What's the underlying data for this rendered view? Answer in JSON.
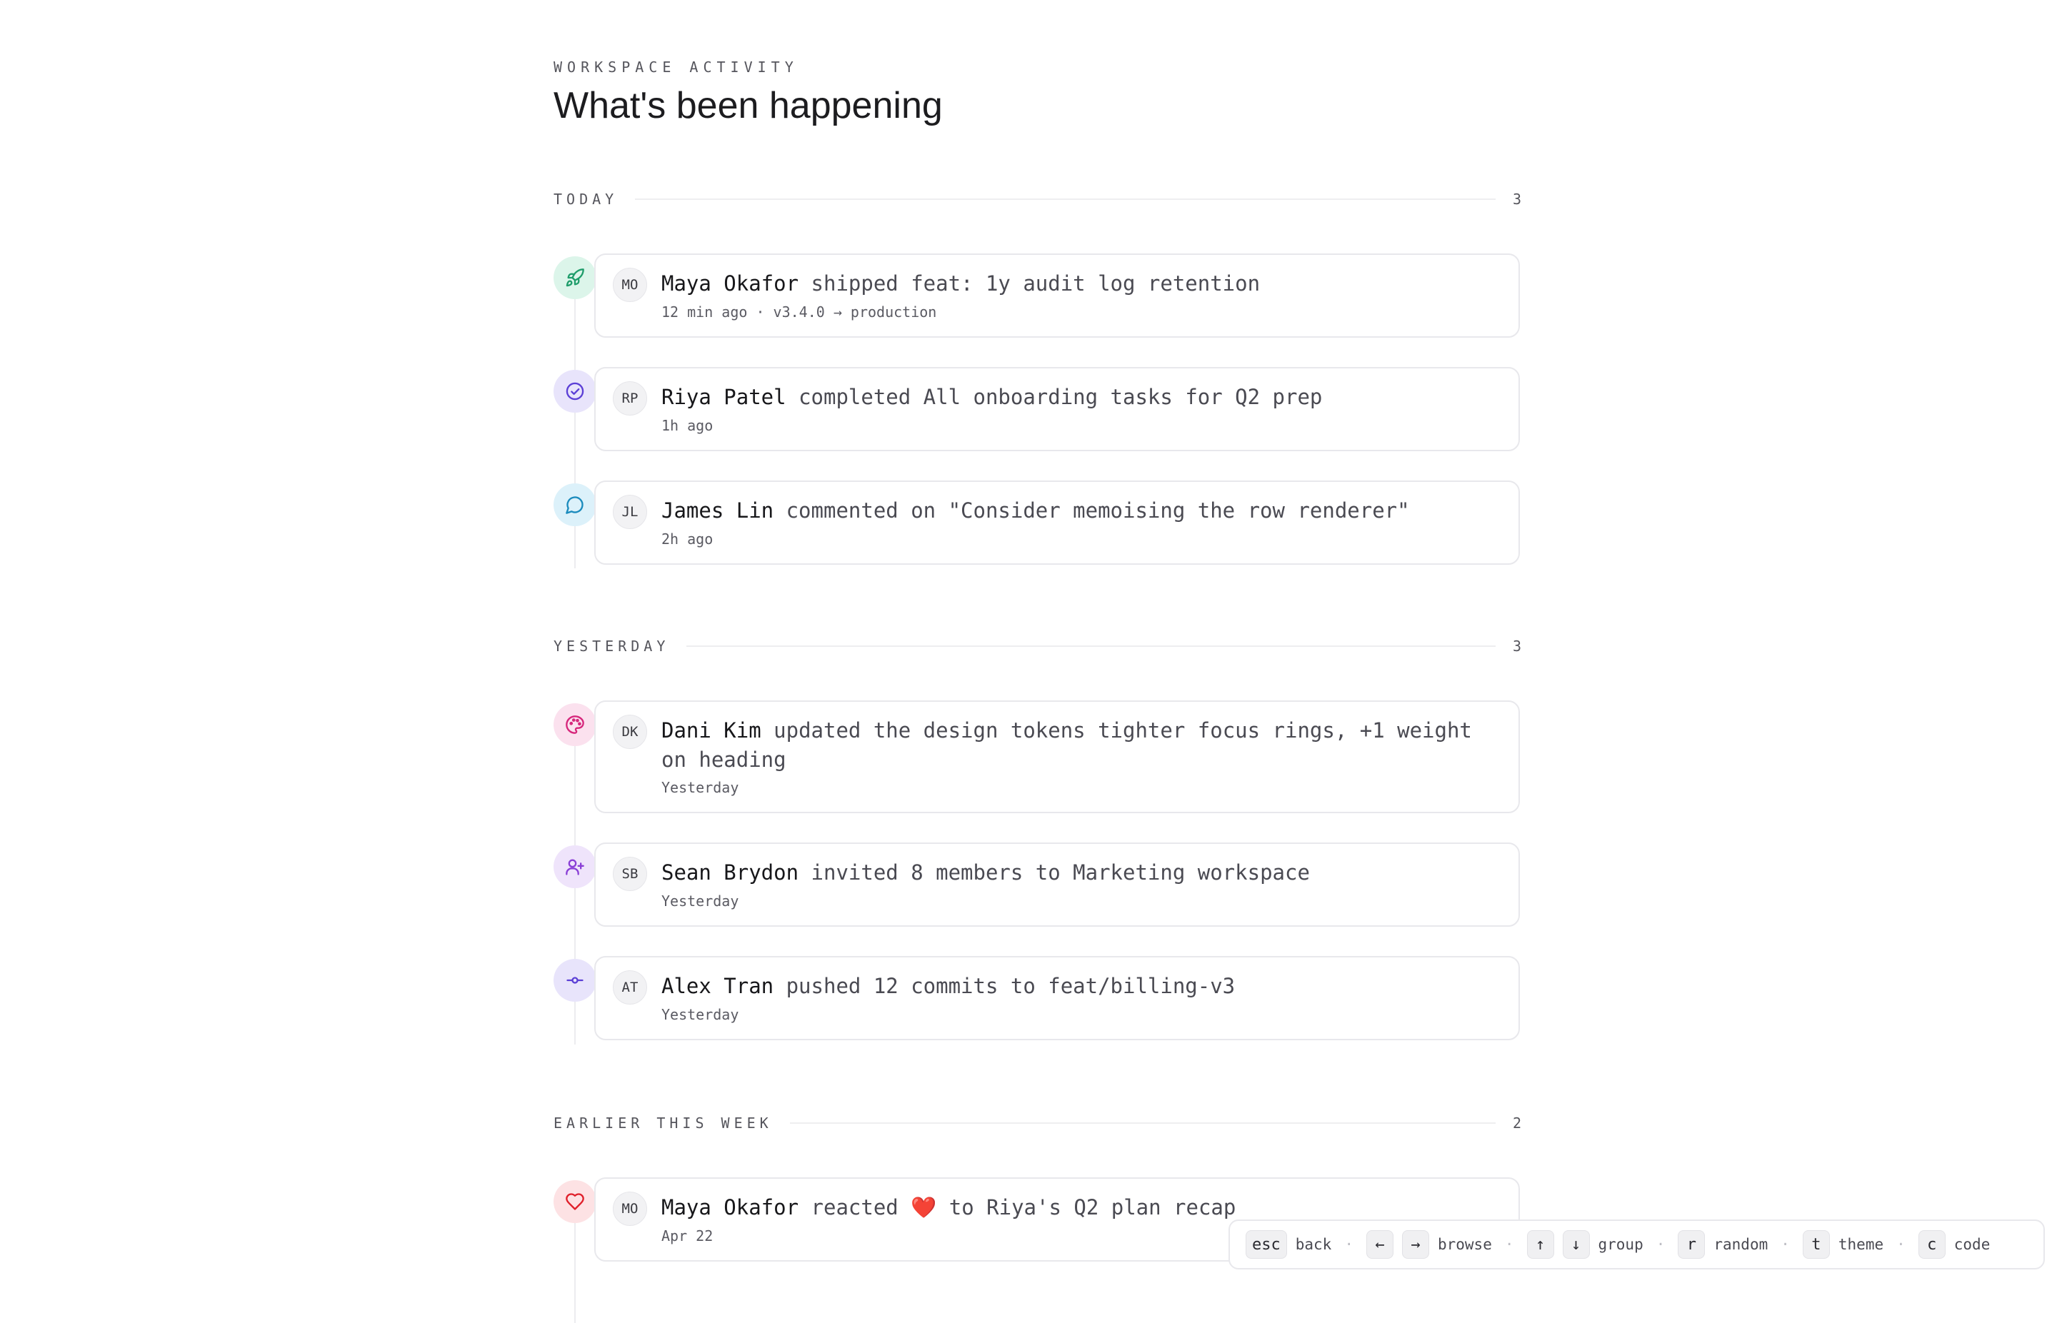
{
  "header": {
    "eyebrow": "WORKSPACE ACTIVITY",
    "title": "What's been happening"
  },
  "sections": [
    {
      "label": "TODAY",
      "count": "3",
      "items": [
        {
          "icon": "rocket-icon",
          "initials": "MO",
          "actor": "Maya Okafor",
          "action": " shipped feat: 1y audit log retention",
          "meta": "12 min ago · v3.4.0 → production"
        },
        {
          "icon": "check-circle-icon",
          "initials": "RP",
          "actor": "Riya Patel",
          "action": " completed All onboarding tasks for Q2 prep",
          "meta": "1h ago"
        },
        {
          "icon": "comment-icon",
          "initials": "JL",
          "actor": "James Lin",
          "action": " commented on \"Consider memoising the row renderer\"",
          "meta": "2h ago"
        }
      ]
    },
    {
      "label": "YESTERDAY",
      "count": "3",
      "items": [
        {
          "icon": "palette-icon",
          "initials": "DK",
          "actor": "Dani Kim",
          "action": " updated the design tokens tighter focus rings, +1 weight on heading",
          "meta": "Yesterday"
        },
        {
          "icon": "user-plus-icon",
          "initials": "SB",
          "actor": "Sean Brydon",
          "action": " invited 8 members to Marketing workspace",
          "meta": "Yesterday"
        },
        {
          "icon": "commit-icon",
          "initials": "AT",
          "actor": "Alex Tran",
          "action": " pushed 12 commits to feat/billing-v3",
          "meta": "Yesterday"
        }
      ]
    },
    {
      "label": "EARLIER THIS WEEK",
      "count": "2",
      "items": [
        {
          "icon": "heart-icon",
          "initials": "MO",
          "actor": "Maya Okafor",
          "action_before": " reacted ",
          "emoji": "❤️",
          "action_after": "  to Riya's Q2 plan recap",
          "meta": "Apr 22"
        }
      ]
    }
  ],
  "shortcuts": [
    {
      "keys": [
        "esc"
      ],
      "label": "back"
    },
    {
      "keys": [
        "←",
        "→"
      ],
      "label": "browse"
    },
    {
      "keys": [
        "↑",
        "↓"
      ],
      "label": "group"
    },
    {
      "keys": [
        "r"
      ],
      "label": "random"
    },
    {
      "keys": [
        "t"
      ],
      "label": "theme"
    },
    {
      "keys": [
        "c"
      ],
      "label": "code"
    }
  ],
  "colors": {
    "rocket": "#1f9d6b",
    "rocket_bg": "#dcf5ea",
    "check": "#5b3fd6",
    "check_bg": "#e8e4fb",
    "comment": "#1a8bbd",
    "comment_bg": "#dcf1fa",
    "palette": "#d6267b",
    "palette_bg": "#fbe1ee",
    "userplus": "#8a3fd6",
    "userplus_bg": "#efe4fb",
    "commit": "#5b3fd6",
    "commit_bg": "#e8e4fb",
    "heart": "#e0202b",
    "heart_bg": "#fde2e4"
  }
}
